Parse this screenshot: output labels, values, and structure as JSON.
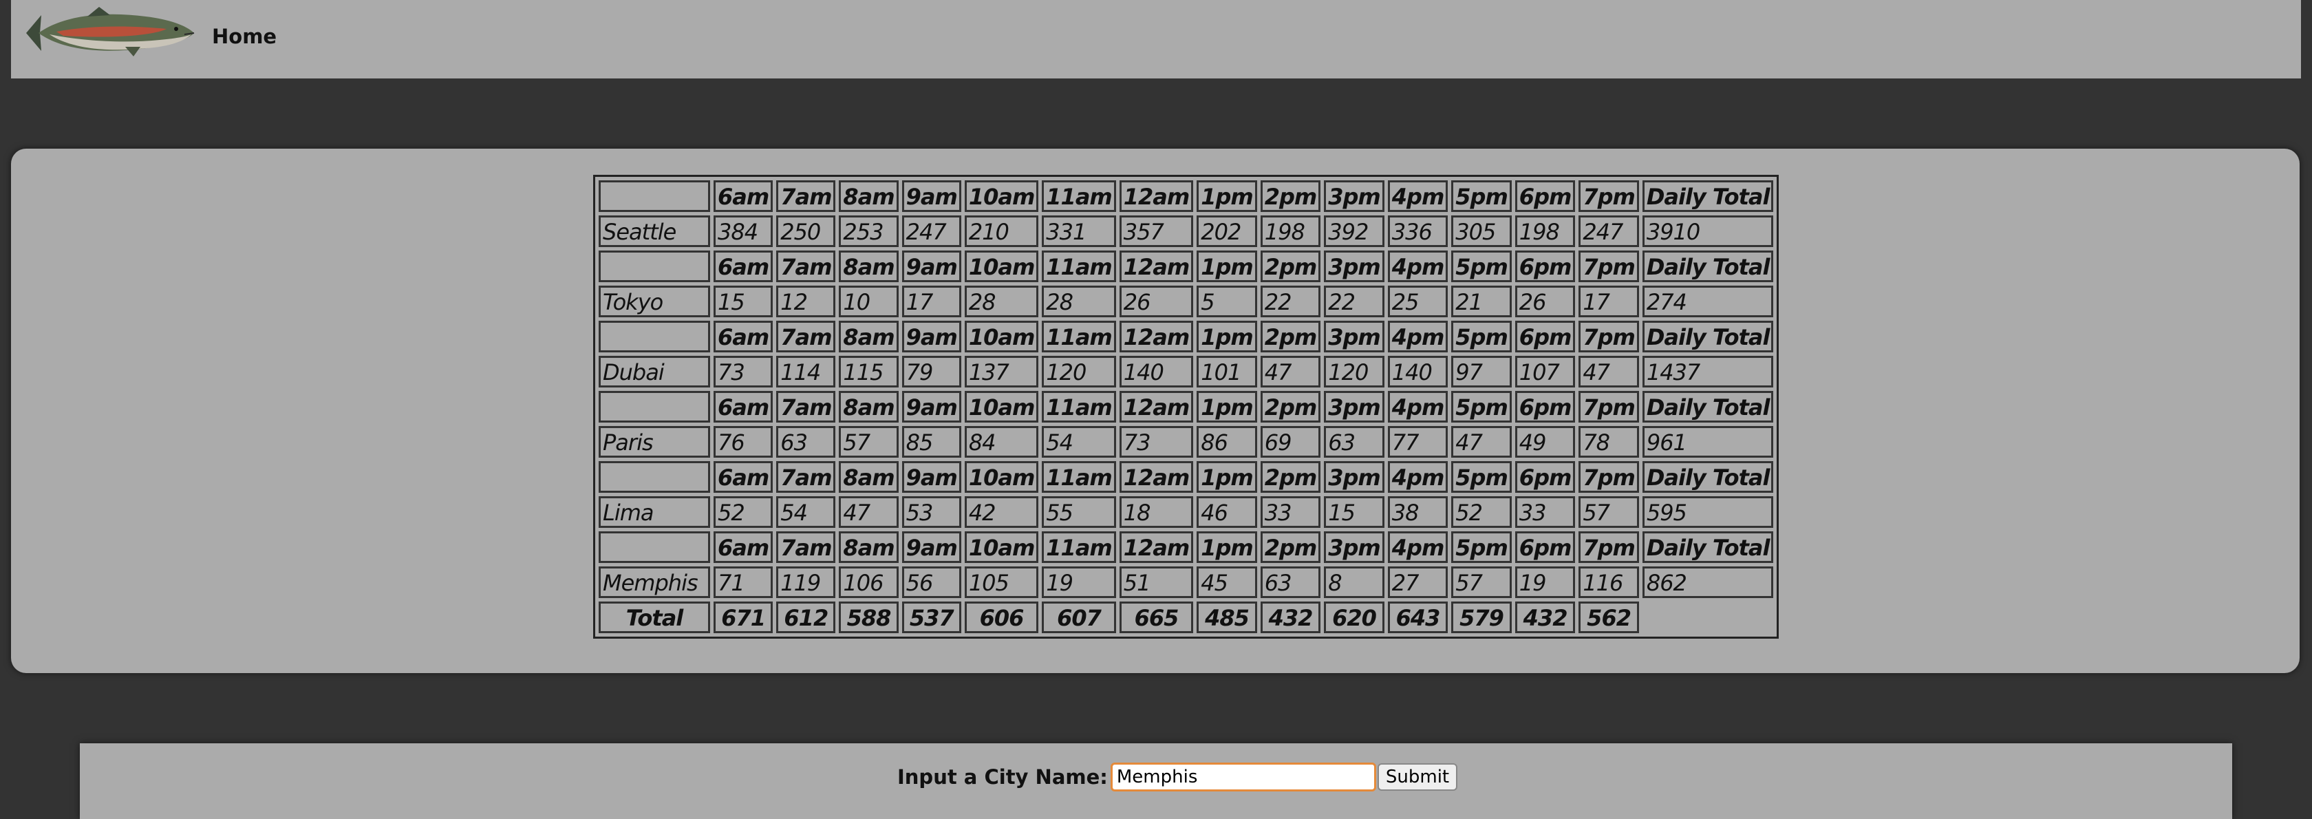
{
  "header": {
    "logo_icon": "salmon-fish-icon",
    "home_label": "Home"
  },
  "table": {
    "hours": [
      "6am",
      "7am",
      "8am",
      "9am",
      "10am",
      "11am",
      "12am",
      "1pm",
      "2pm",
      "3pm",
      "4pm",
      "5pm",
      "6pm",
      "7pm"
    ],
    "daily_total_label": "Daily Total",
    "cities": [
      {
        "name": "Seattle",
        "values": [
          "384",
          "250",
          "253",
          "247",
          "210",
          "331",
          "357",
          "202",
          "198",
          "392",
          "336",
          "305",
          "198",
          "247"
        ],
        "total": "3910"
      },
      {
        "name": "Tokyo",
        "values": [
          "15",
          "12",
          "10",
          "17",
          "28",
          "28",
          "26",
          "5",
          "22",
          "22",
          "25",
          "21",
          "26",
          "17"
        ],
        "total": "274"
      },
      {
        "name": "Dubai",
        "values": [
          "73",
          "114",
          "115",
          "79",
          "137",
          "120",
          "140",
          "101",
          "47",
          "120",
          "140",
          "97",
          "107",
          "47"
        ],
        "total": "1437"
      },
      {
        "name": "Paris",
        "values": [
          "76",
          "63",
          "57",
          "85",
          "84",
          "54",
          "73",
          "86",
          "69",
          "63",
          "77",
          "47",
          "49",
          "78"
        ],
        "total": "961"
      },
      {
        "name": "Lima",
        "values": [
          "52",
          "54",
          "47",
          "53",
          "42",
          "55",
          "18",
          "46",
          "33",
          "15",
          "38",
          "52",
          "33",
          "57"
        ],
        "total": "595"
      },
      {
        "name": "Memphis",
        "values": [
          "71",
          "119",
          "106",
          "56",
          "105",
          "19",
          "51",
          "45",
          "63",
          "8",
          "27",
          "57",
          "19",
          "116"
        ],
        "total": "862"
      }
    ],
    "totals_label": "Total",
    "hourly_totals": [
      "671",
      "612",
      "588",
      "537",
      "606",
      "607",
      "665",
      "485",
      "432",
      "620",
      "643",
      "579",
      "432",
      "562"
    ]
  },
  "form": {
    "label": "Input a City Name:",
    "input_value": "Memphis",
    "submit_label": "Submit"
  },
  "colors": {
    "page_background": "#333333",
    "panel_background": "#ababab",
    "input_focus_border": "#e58a3a"
  }
}
